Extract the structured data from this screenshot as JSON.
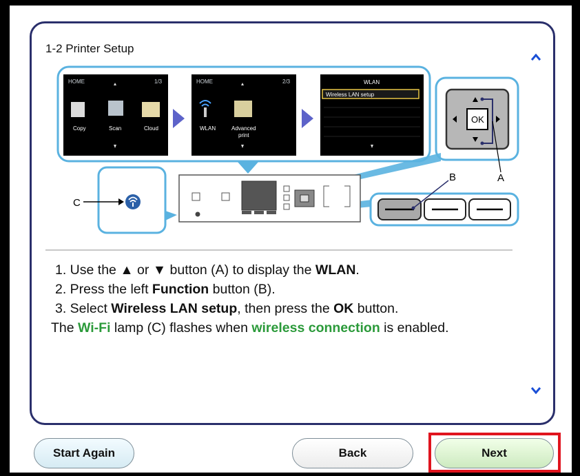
{
  "panel": {
    "title": "1-2 Printer Setup"
  },
  "screens": [
    {
      "header_left": "HOME",
      "header_right": "1/3",
      "items": [
        "Copy",
        "Scan",
        "Cloud"
      ]
    },
    {
      "header_left": "HOME",
      "header_right": "2/3",
      "items": [
        "WLAN",
        "Advanced",
        "print"
      ]
    },
    {
      "header_center": "WLAN",
      "selected": "Wireless LAN setup"
    }
  ],
  "callouts": {
    "a": "A",
    "b": "B",
    "c": "C"
  },
  "keypad_ok": "OK",
  "instructions": {
    "step1": {
      "pre": "1. Use the ",
      "up": "▲",
      "or": " or ",
      "down": "▼",
      "mid": " button (A) to display the ",
      "bold": "WLAN",
      "post": "."
    },
    "step2": {
      "pre": "2. Press the left ",
      "bold": "Function",
      "post": " button (B)."
    },
    "step3": {
      "pre": "3. Select ",
      "bold1": "Wireless LAN setup",
      "mid": ", then press the ",
      "bold2": "OK",
      "post": " button."
    },
    "note": {
      "pre": "The ",
      "green1": "Wi-Fi",
      "mid": " lamp (C) flashes when ",
      "green2": "wireless connection",
      "post": " is enabled."
    }
  },
  "buttons": {
    "start_again": "Start Again",
    "back": "Back",
    "next": "Next"
  },
  "colors": {
    "panel_border": "#2a2f6b",
    "accent_blue": "#1a4fd6",
    "green_text": "#2b9a3a",
    "highlight_red": "#e0141e",
    "callout_blue": "#5ab2e0",
    "arrow_purple": "#5d63c9"
  }
}
